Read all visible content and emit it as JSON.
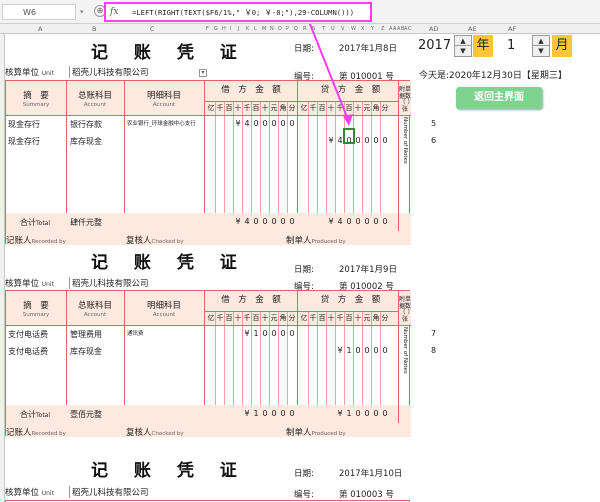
{
  "formula_bar": {
    "name_box": "W6",
    "fx_label": "fx",
    "formula": "=LEFT(RIGHT(TEXT($F6/1%,\" ￥0; ￥-0;\"),29-COLUMN()))"
  },
  "column_headers": [
    "A",
    "B",
    "C",
    "F",
    "G",
    "H",
    "I",
    "J",
    "K",
    "L",
    "M",
    "N",
    "O",
    "P",
    "Q",
    "R",
    "S",
    "T",
    "U",
    "V",
    "W",
    "X",
    "Y",
    "Z",
    "AA",
    "AB",
    "AC",
    "AD",
    "AE",
    "AF"
  ],
  "vouchers": [
    {
      "title": "记 账 凭 证",
      "date_label": "日期:",
      "date": "2017年1月8日",
      "unit_label": "核算单位",
      "unit_sub": "Unit",
      "company": "稻壳儿科技有限公司",
      "number_label": "编号:",
      "number": "第 010001 号",
      "rows": [
        {
          "summary": "现金存行",
          "general": "银行存款",
          "detail": "农业银行_环球金融中心支行",
          "debit": [
            "",
            "",
            "",
            "¥",
            "4",
            "0",
            "0",
            "0",
            "0",
            "0"
          ],
          "credit": [
            "",
            "",
            "",
            "",
            "",
            "",
            "",
            "",
            "",
            ""
          ],
          "aux": "5"
        },
        {
          "summary": "现金存行",
          "general": "库存现金",
          "detail": "",
          "debit": [
            "",
            "",
            "",
            "",
            "",
            "",
            "",
            "",
            "",
            ""
          ],
          "credit": [
            "",
            "",
            "",
            "¥",
            "4",
            "0",
            "0",
            "0",
            "0",
            "0"
          ],
          "aux": "6"
        }
      ],
      "total_label": "合计",
      "total_sub": "Total",
      "total_text": "肆仟元整",
      "total_debit": [
        "",
        "",
        "",
        "¥",
        "4",
        "0",
        "0",
        "0",
        "0",
        "0"
      ],
      "total_credit": [
        "",
        "",
        "",
        "¥",
        "4",
        "0",
        "0",
        "0",
        "0",
        "0"
      ],
      "attach_note": "附单据数（ ）张",
      "notes_en": "Number of Notes"
    },
    {
      "title": "记 账 凭 证",
      "date_label": "日期:",
      "date": "2017年1月9日",
      "unit_label": "核算单位",
      "unit_sub": "Unit",
      "company": "稻壳儿科技有限公司",
      "number_label": "编号:",
      "number": "第 010002 号",
      "rows": [
        {
          "summary": "支付电话费",
          "general": "管理费用",
          "detail": "通讯费",
          "debit": [
            "",
            "",
            "",
            "",
            "¥",
            "1",
            "0",
            "0",
            "0",
            "0"
          ],
          "credit": [
            "",
            "",
            "",
            "",
            "",
            "",
            "",
            "",
            "",
            ""
          ],
          "aux": "7"
        },
        {
          "summary": "支付电话费",
          "general": "库存现金",
          "detail": "",
          "debit": [
            "",
            "",
            "",
            "",
            "",
            "",
            "",
            "",
            "",
            ""
          ],
          "credit": [
            "",
            "",
            "",
            "",
            "¥",
            "1",
            "0",
            "0",
            "0",
            "0"
          ],
          "aux": "8"
        }
      ],
      "total_label": "合计",
      "total_sub": "Total",
      "total_text": "壹佰元整",
      "total_debit": [
        "",
        "",
        "",
        "",
        "¥",
        "1",
        "0",
        "0",
        "0",
        "0"
      ],
      "total_credit": [
        "",
        "",
        "",
        "",
        "¥",
        "1",
        "0",
        "0",
        "0",
        "0"
      ],
      "attach_note": "附单据数（ ）张",
      "notes_en": "Number of Notes"
    },
    {
      "title": "记 账 凭 证",
      "date_label": "日期:",
      "date": "2017年1月10日",
      "unit_label": "核算单位",
      "unit_sub": "Unit",
      "company": "稻壳儿科技有限公司",
      "number_label": "编号:",
      "number": "第 010003 号"
    }
  ],
  "table_headers": {
    "summary": "摘　要",
    "summary_en": "Summary",
    "general": "总账科目",
    "general_en": "Account",
    "detail": "明细科目",
    "detail_en": "Account",
    "debit": "借　方　金　额",
    "credit": "贷　方　金　额",
    "digits": [
      "亿",
      "千",
      "百",
      "十",
      "万",
      "千",
      "百",
      "十",
      "元",
      "角",
      "分"
    ]
  },
  "signatures": {
    "recorder": "记账人",
    "recorder_en": "Recorded by",
    "checker": "复核人",
    "checker_en": "Checked by",
    "producer": "制单人",
    "producer_en": "Produced by"
  },
  "right_panel": {
    "year": "2017",
    "year_unit": "年",
    "month": "1",
    "month_unit": "月",
    "today_text": "今天是:2020年12月30日【星期三】",
    "back_button": "返回主界面",
    "accent_color": "#7fd38f",
    "unit_bg": "#fcc63a"
  },
  "colors": {
    "grid_red": "#e06666",
    "header_pink": "#fde9df",
    "highlight_magenta": "#ff3df2",
    "selection_green": "#2e8b2e"
  }
}
